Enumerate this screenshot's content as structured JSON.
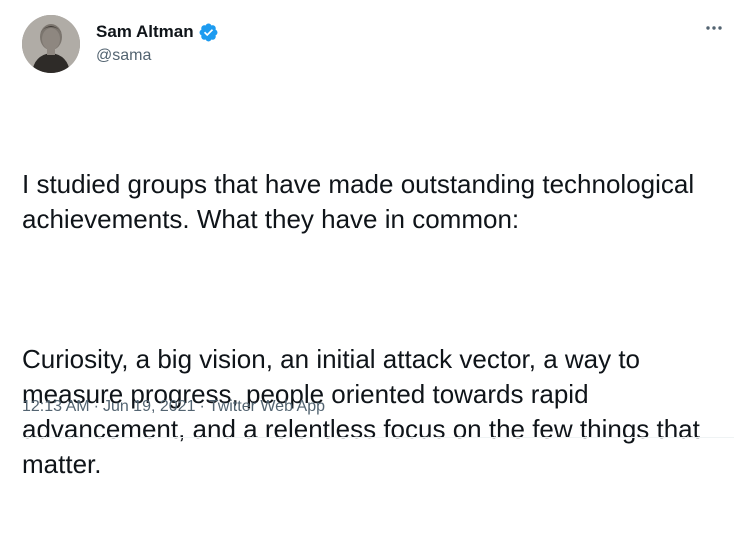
{
  "author": {
    "name": "Sam Altman",
    "handle": "@sama",
    "verified": true,
    "verified_color": "#1d9bf0"
  },
  "menu": {
    "icon": "more-horizontal-icon"
  },
  "tweet": {
    "paragraphs": [
      "I studied groups that have made outstanding technological achievements. What they have in common:",
      "Curiosity, a big vision, an initial attack vector, a way to measure progress, people oriented towards rapid advancement, and a relentless focus on the few things that matter."
    ]
  },
  "meta": {
    "time": "12:13 AM",
    "date": "Jun 19, 2021",
    "separator": "·",
    "source": "Twitter Web App"
  },
  "colors": {
    "text": "#0f1419",
    "secondary": "#536471",
    "divider": "#eff3f4"
  }
}
